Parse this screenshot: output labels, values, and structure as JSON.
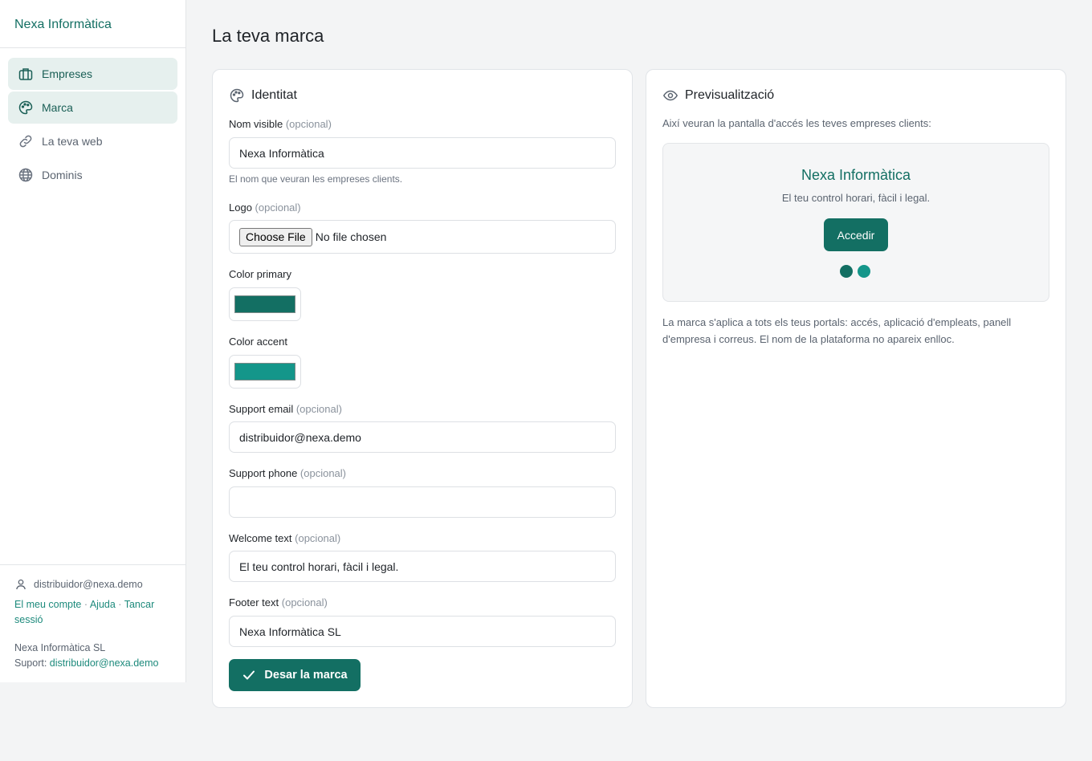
{
  "sidebar": {
    "brand": "Nexa Informàtica",
    "items": [
      {
        "label": "Empreses",
        "icon": "building-icon",
        "active": true
      },
      {
        "label": "Marca",
        "icon": "palette-icon",
        "active": true
      },
      {
        "label": "La teva web",
        "icon": "link-icon",
        "active": false
      },
      {
        "label": "Dominis",
        "icon": "globe-icon",
        "active": false
      }
    ],
    "footer": {
      "user_email": "distribuidor@nexa.demo",
      "link_account": "El meu compte",
      "link_help": "Ajuda",
      "link_logout": "Tancar sessió",
      "separator": "·",
      "company": "Nexa Informàtica SL",
      "support_label": "Suport:",
      "support_email": "distribuidor@nexa.demo"
    }
  },
  "page": {
    "title": "La teva marca"
  },
  "identity": {
    "heading": "Identitat",
    "optional": "(opcional)",
    "visible_name": {
      "label": "Nom visible",
      "value": "Nexa Informàtica",
      "hint": "El nom que veuran les empreses clients."
    },
    "logo": {
      "label": "Logo",
      "button": "Choose File",
      "status": "No file chosen"
    },
    "primary_color": {
      "label": "Color primary",
      "value": "#136f63"
    },
    "accent_color": {
      "label": "Color accent",
      "value": "#14968a"
    },
    "support_email": {
      "label": "Support email",
      "value": "distribuidor@nexa.demo"
    },
    "support_phone": {
      "label": "Support phone",
      "value": ""
    },
    "welcome_text": {
      "label": "Welcome text",
      "value": "El teu control horari, fàcil i legal."
    },
    "footer_text": {
      "label": "Footer text",
      "value": "Nexa Informàtica SL"
    },
    "save_button": "Desar la marca"
  },
  "preview": {
    "heading": "Previsualització",
    "intro": "Així veuran la pantalla d'accés les teves empreses clients:",
    "name": "Nexa Informàtica",
    "welcome": "El teu control horari, fàcil i legal.",
    "button": "Accedir",
    "dot_colors": [
      "#136f63",
      "#14968a"
    ],
    "note": "La marca s'aplica a tots els teus portals: accés, aplicació d'empleats, panell d'empresa i correus. El nom de la plataforma no apareix enlloc."
  }
}
